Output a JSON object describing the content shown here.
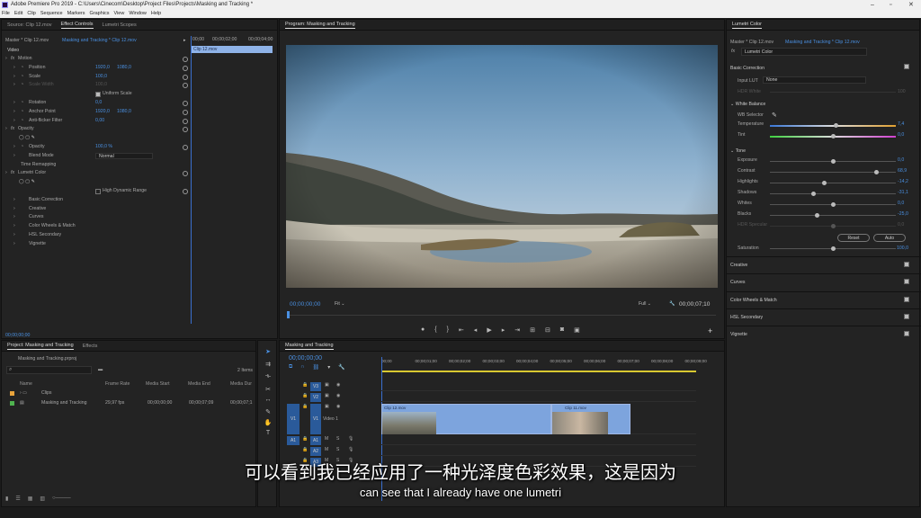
{
  "window": {
    "title": "Adobe Premiere Pro 2019 - C:\\Users\\Cinecom\\Desktop\\Project Files\\Projects\\Masking and Tracking *"
  },
  "menu": [
    "File",
    "Edit",
    "Clip",
    "Sequence",
    "Markers",
    "Graphics",
    "View",
    "Window",
    "Help"
  ],
  "source_panel": {
    "tabs": [
      "Source: Clip 12.mov",
      "Effect Controls",
      "Lumetri Scopes"
    ],
    "active_tab": "Effect Controls",
    "master": "Master * Clip 12.mov",
    "sequence": "Masking and Tracking * Clip 12.mov",
    "timecodes": [
      "00;00",
      "00;00;02;00",
      "00;00;04;00"
    ],
    "clip_label": "Clip 12.mov",
    "section": "Video",
    "rows": [
      {
        "name": "Motion",
        "indent": 1,
        "fx": true
      },
      {
        "name": "Position",
        "indent": 2,
        "v1": "1920,0",
        "v2": "1080,0"
      },
      {
        "name": "Scale",
        "indent": 2,
        "v1": "100,0"
      },
      {
        "name": "Scale Width",
        "indent": 2,
        "v1": "100,0",
        "dim": true
      },
      {
        "name": "Uniform Scale",
        "indent": 3,
        "check": true
      },
      {
        "name": "Rotation",
        "indent": 2,
        "v1": "0,0"
      },
      {
        "name": "Anchor Point",
        "indent": 2,
        "v1": "1920,0",
        "v2": "1080,0"
      },
      {
        "name": "Anti-flicker Filter",
        "indent": 2,
        "v1": "0,00"
      },
      {
        "name": "Opacity",
        "indent": 1,
        "fx": true
      },
      {
        "name": "",
        "indent": 2,
        "masks": true
      },
      {
        "name": "Opacity",
        "indent": 2,
        "v1": "100,0 %"
      },
      {
        "name": "Blend Mode",
        "indent": 2,
        "select": "Normal"
      },
      {
        "name": "Time Remapping",
        "indent": 1
      },
      {
        "name": "Lumetri Color",
        "indent": 1,
        "fx": true
      },
      {
        "name": "",
        "indent": 2,
        "masks": true
      },
      {
        "name": "High Dynamic Range",
        "indent": 3,
        "check2": true
      },
      {
        "name": "Basic Correction",
        "indent": 2
      },
      {
        "name": "Creative",
        "indent": 2
      },
      {
        "name": "Curves",
        "indent": 2
      },
      {
        "name": "Color Wheels & Match",
        "indent": 2
      },
      {
        "name": "HSL Secondary",
        "indent": 2
      },
      {
        "name": "Vignette",
        "indent": 2
      }
    ],
    "footer_time": "00;00;00;00"
  },
  "program": {
    "title": "Program: Masking and Tracking",
    "timecode": "00;00;00;00",
    "fit": "Fit",
    "quality": "Full",
    "duration": "00;00;07;10"
  },
  "project": {
    "tabs": [
      "Project: Masking and Tracking",
      "Effects"
    ],
    "file": "Masking and Tracking.prproj",
    "items_count": "2 Items",
    "columns": [
      "Name",
      "Frame Rate",
      "Media Start",
      "Media End",
      "Media Dur"
    ],
    "items": [
      {
        "name": "Clips",
        "color": "#e8a33b",
        "rate": "",
        "start": "",
        "end": "",
        "dur": ""
      },
      {
        "name": "Masking and Tracking",
        "color": "#4fb34f",
        "rate": "29,97 fps",
        "start": "00;00;00;00",
        "end": "00;00;07;09",
        "dur": "00;00;07;1"
      }
    ]
  },
  "timeline": {
    "title": "Masking and Tracking",
    "timecode": "00;00;00;00",
    "ruler": [
      "00;00",
      "00;00;01;00",
      "00;00;02;00",
      "00;00;03;00",
      "00;00;04;00",
      "00;00;05;00",
      "00;00;06;00",
      "00;00;07;00",
      "00;00;08;00",
      "00;00;09;00"
    ],
    "tracks": [
      "V3",
      "V2",
      "V1",
      "A1",
      "A2",
      "A3"
    ],
    "video1_label": "Video 1",
    "clip1": "Clip 12.mov",
    "clip2": "Clip 11.mov"
  },
  "lumetri": {
    "title": "Lumetri Color",
    "master": "Master * Clip 12.mov",
    "sequence": "Masking and Tracking * Clip 12.mov",
    "effect": "Lumetri Color",
    "basic_correction": "Basic Correction",
    "input_lut": "Input LUT",
    "input_lut_value": "None",
    "hdr_white": "HDR White",
    "hdr_white_value": "100",
    "white_balance": "White Balance",
    "wb_selector": "WB Selector",
    "tone": "Tone",
    "sliders": [
      {
        "name": "Temperature",
        "value": "7,4",
        "pos": 0.52,
        "grad": "temp"
      },
      {
        "name": "Tint",
        "value": "0,0",
        "pos": 0.5,
        "grad": "tint"
      },
      {
        "name": "Exposure",
        "value": "0,0",
        "pos": 0.5
      },
      {
        "name": "Contrast",
        "value": "68,9",
        "pos": 0.84
      },
      {
        "name": "Highlights",
        "value": "-14,2",
        "pos": 0.43
      },
      {
        "name": "Shadows",
        "value": "-31,1",
        "pos": 0.34
      },
      {
        "name": "Whites",
        "value": "0,0",
        "pos": 0.5
      },
      {
        "name": "Blacks",
        "value": "-25,0",
        "pos": 0.37
      },
      {
        "name": "HDR Specular",
        "value": "0,0",
        "pos": 0.5,
        "dim": true
      }
    ],
    "reset": "Reset",
    "auto": "Auto",
    "saturation": "Saturation",
    "saturation_value": "100,0",
    "sections": [
      "Creative",
      "Curves",
      "Color Wheels & Match",
      "HSL Secondary",
      "Vignette"
    ]
  },
  "subtitles": {
    "cn": "可以看到我已经应用了一种光泽度色彩效果，这是因为",
    "en": "can see that I already have one lumetri"
  }
}
